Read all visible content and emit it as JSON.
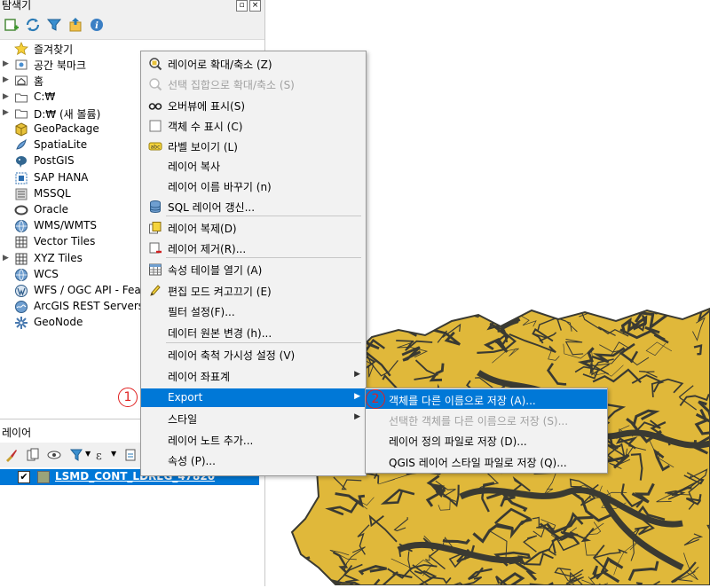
{
  "browser": {
    "title": "탐색기",
    "items": [
      {
        "label": "즐겨찾기",
        "icon": "star-icon",
        "has_arrow": false
      },
      {
        "label": "공간 북마크",
        "icon": "bookmark-icon",
        "has_arrow": true
      },
      {
        "label": "홈",
        "icon": "home-folder-icon",
        "has_arrow": true
      },
      {
        "label": "C:₩",
        "icon": "folder-icon",
        "has_arrow": true
      },
      {
        "label": "D:₩ (새 볼륨)",
        "icon": "folder-icon",
        "has_arrow": true
      },
      {
        "label": "GeoPackage",
        "icon": "geopackage-icon",
        "has_arrow": false
      },
      {
        "label": "SpatiaLite",
        "icon": "spatialite-icon",
        "has_arrow": false
      },
      {
        "label": "PostGIS",
        "icon": "postgis-icon",
        "has_arrow": false
      },
      {
        "label": "SAP HANA",
        "icon": "sap-hana-icon",
        "has_arrow": false
      },
      {
        "label": "MSSQL",
        "icon": "mssql-icon",
        "has_arrow": false
      },
      {
        "label": "Oracle",
        "icon": "oracle-icon",
        "has_arrow": false
      },
      {
        "label": "WMS/WMTS",
        "icon": "globe-icon",
        "has_arrow": false
      },
      {
        "label": "Vector Tiles",
        "icon": "grid-icon",
        "has_arrow": false
      },
      {
        "label": "XYZ Tiles",
        "icon": "grid-icon",
        "has_arrow": true
      },
      {
        "label": "WCS",
        "icon": "globe-icon",
        "has_arrow": false
      },
      {
        "label": "WFS / OGC API - Feat",
        "icon": "wfs-icon",
        "has_arrow": false
      },
      {
        "label": "ArcGIS REST Servers",
        "icon": "arcgis-icon",
        "has_arrow": false
      },
      {
        "label": "GeoNode",
        "icon": "geonode-icon",
        "has_arrow": false
      }
    ]
  },
  "layers": {
    "title": "레이어",
    "layer_name": "LSMD_CONT_LDREG_47820",
    "swatch_color": "#9aa37a"
  },
  "context_menu": {
    "items": [
      {
        "label": "레이어로 확대/축소 (Z)",
        "icon": "zoom-layer-icon",
        "disabled": false
      },
      {
        "label": "선택 집합으로 확대/축소 (S)",
        "icon": "zoom-selection-icon",
        "disabled": true
      },
      {
        "label": "오버뷰에 표시(S)",
        "icon": "overview-icon",
        "disabled": false
      },
      {
        "label": "객체 수 표시 (C)",
        "icon": "checkbox-icon",
        "disabled": false
      },
      {
        "label": "라벨 보이기 (L)",
        "icon": "label-icon",
        "disabled": false
      },
      {
        "label": "레이어 복사",
        "icon": "",
        "disabled": false
      },
      {
        "label": "레이어 이름 바꾸기 (n)",
        "icon": "",
        "disabled": false
      },
      {
        "label": "SQL 레이어 갱신...",
        "icon": "database-icon",
        "disabled": false
      },
      {
        "label": "레이어 복제(D)",
        "icon": "duplicate-icon",
        "disabled": false
      },
      {
        "label": "레이어 제거(R)...",
        "icon": "remove-layer-icon",
        "disabled": false
      },
      {
        "label": "속성 테이블 열기 (A)",
        "icon": "table-icon",
        "disabled": false
      },
      {
        "label": "편집 모드 켜고끄기 (E)",
        "icon": "pencil-icon",
        "disabled": false
      },
      {
        "label": "필터 설정(F)...",
        "icon": "",
        "disabled": false
      },
      {
        "label": "데이터 원본 변경 (h)...",
        "icon": "",
        "disabled": false
      },
      {
        "label": "레이어 축척 가시성 설정 (V)",
        "icon": "",
        "disabled": false
      },
      {
        "label": "레이어 좌표계",
        "icon": "",
        "disabled": false,
        "submenu": true
      },
      {
        "label": "Export",
        "icon": "",
        "disabled": false,
        "submenu": true,
        "active": true
      },
      {
        "label": "스타일",
        "icon": "",
        "disabled": false,
        "submenu": true
      },
      {
        "label": "레이어 노트 추가...",
        "icon": "",
        "disabled": false
      },
      {
        "label": "속성 (P)...",
        "icon": "",
        "disabled": false
      }
    ]
  },
  "export_submenu": {
    "items": [
      {
        "label": "객체를 다른 이름으로 저장 (A)...",
        "active": true,
        "disabled": false
      },
      {
        "label": "선택한 객체를 다른 이름으로 저장 (S)...",
        "active": false,
        "disabled": true
      },
      {
        "label": "레이어 정의 파일로 저장 (D)...",
        "active": false,
        "disabled": false
      },
      {
        "label": "QGIS 레이어 스타일 파일로 저장 (Q)...",
        "active": false,
        "disabled": false
      }
    ]
  },
  "markers": {
    "step1": "1",
    "step2": "2"
  },
  "colors": {
    "selection": "#0078d7",
    "map_fill": "#e0b83a",
    "map_stroke": "#3a3a32",
    "marker": "#e02020"
  }
}
